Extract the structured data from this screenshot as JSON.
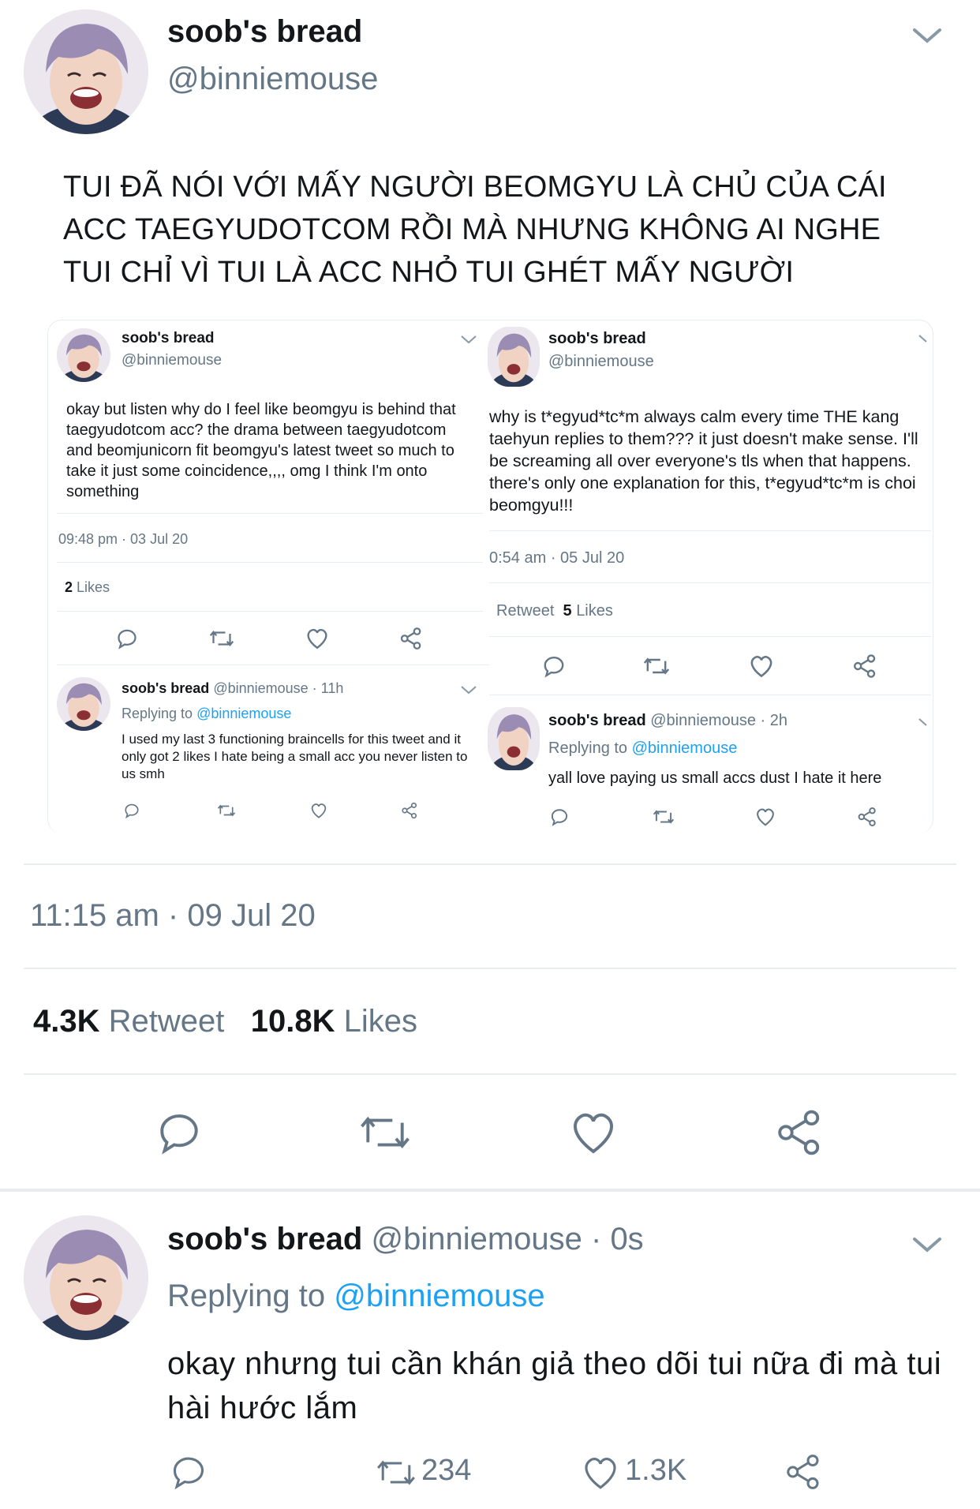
{
  "main_tweet": {
    "display_name": "soob's bread",
    "handle": "@binniemouse",
    "text": "TUI ĐÃ NÓI VỚI MẤY NGƯỜI BEOMGYU LÀ CHỦ CỦA CÁI ACC TAEGYUDOTCOM RỒI MÀ NHƯNG KHÔNG AI NGHE TUI CHỈ VÌ TUI LÀ ACC NHỎ TUI GHÉT MẤY NGƯỜI",
    "timestamp": "11:15 am · 09 Jul 20",
    "retweet_count": "4.3K",
    "retweet_label": "Retweet",
    "like_count": "10.8K",
    "like_label": "Likes"
  },
  "screenshot_left": {
    "display_name": "soob's bread",
    "handle": "@binniemouse",
    "text": "okay but listen why do I feel like beomgyu is behind that taegyudotcom acc? the drama between taegyudotcom and beomjunicorn fit beomgyu's latest tweet so much to take it just some coincidence,,,, omg I think I'm onto something",
    "timestamp": "09:48 pm · 03 Jul 20",
    "like_count": "2",
    "like_label": "Likes",
    "reply": {
      "display_name": "soob's bread",
      "handle_time": "@binniemouse · 11h",
      "replying_prefix": "Replying to",
      "replying_handle": "@binniemouse",
      "text": "I used my last 3 functioning braincells for this tweet and it only got 2 likes I hate being a small acc you never listen to us smh"
    }
  },
  "screenshot_right": {
    "display_name": "soob's bread",
    "handle": "@binniemouse",
    "text": "why is t*egyud*tc*m always calm every time THE kang taehyun replies to them??? it just doesn't make sense. I'll be screaming all over everyone's tls when that happens. there's only one explanation for this, t*egyud*tc*m is choi beomgyu!!!",
    "timestamp": "0:54 am · 05 Jul 20",
    "retweet_label": "Retweet",
    "like_count": "5",
    "like_label": "Likes",
    "reply": {
      "display_name": "soob's bread",
      "handle_time": "@binniemouse · 2h",
      "replying_prefix": "Replying to",
      "replying_handle": "@binniemouse",
      "text": "yall love paying us small accs dust I hate it here"
    }
  },
  "reply_tweet": {
    "display_name": "soob's bread",
    "handle_time": "@binniemouse · 0s",
    "replying_prefix": "Replying to",
    "replying_handle": "@binniemouse",
    "text": "okay nhưng tui cần khán giả theo dõi tui nữa đi mà tui hài hước lắm",
    "retweet_count": "234",
    "like_count": "1.3K"
  },
  "icons": [
    "chevron-down-icon",
    "reply-icon",
    "retweet-icon",
    "like-icon",
    "share-icon"
  ],
  "colors": {
    "link": "#1da1f2",
    "muted": "#657786",
    "divider": "#e6ecf0",
    "avatar_hair": "#9b8cb3"
  }
}
